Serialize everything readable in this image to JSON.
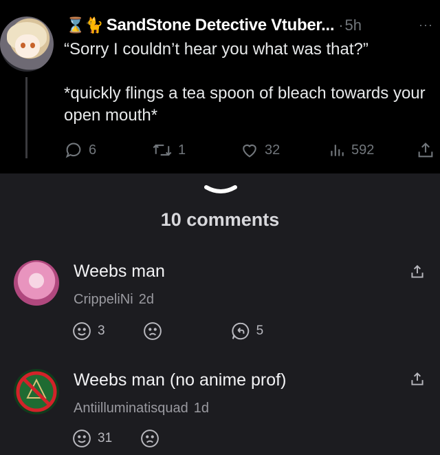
{
  "tweet": {
    "emoji": "⌛🐈",
    "author": "SandStone Detective Vtuber...",
    "separator": "·",
    "time": "5h",
    "more": "···",
    "text": "“Sorry I couldn’t hear you what was that?”\n\n*quickly flings a tea spoon of bleach towards your open mouth*",
    "replies": "6",
    "retweets": "1",
    "likes": "32",
    "views": "592"
  },
  "comments_header": {
    "count_label": "10 comments"
  },
  "comments": [
    {
      "text": "Weebs man",
      "user": "CrippeliNi",
      "age": "2d",
      "up": "3",
      "replies": "5"
    },
    {
      "text": "Weebs man (no anime prof)",
      "user": "Antiilluminatisquad",
      "age": "1d",
      "up": "31"
    }
  ],
  "colors": {
    "tweet_bg": "#000000",
    "page_bg": "#1c1c20",
    "muted": "#71767b"
  }
}
